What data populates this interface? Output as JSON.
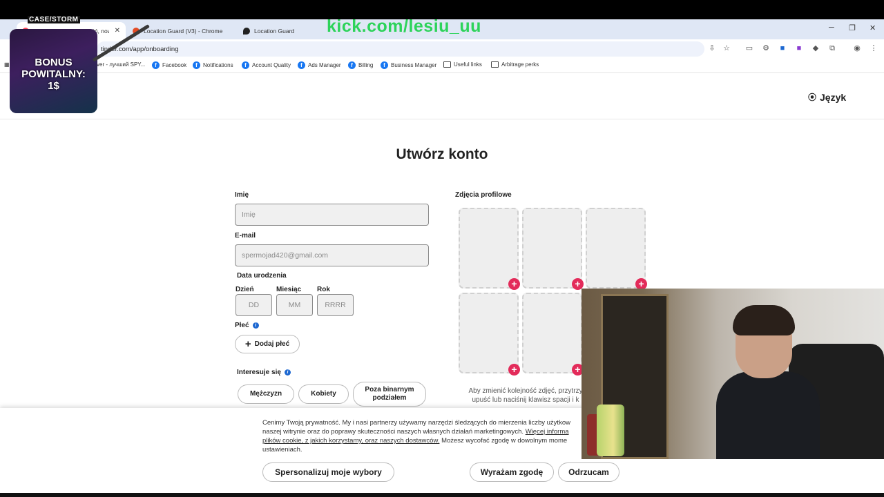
{
  "browser": {
    "tabs": [
      {
        "label": "Tinder | Randki, przyjaźń, nowe",
        "active": true
      },
      {
        "label": "Location Guard (V3) - Chrome",
        "active": false
      },
      {
        "label": "Location Guard",
        "active": false
      }
    ],
    "url": "tinder.com/app/onboarding",
    "bookmarks": [
      {
        "label": "ver - лучший SPY...",
        "icon": "page-icon"
      },
      {
        "label": "Facebook",
        "icon": "facebook-icon"
      },
      {
        "label": "Notifications",
        "icon": "facebook-icon"
      },
      {
        "label": "Account Quality",
        "icon": "facebook-icon"
      },
      {
        "label": "Ads Manager",
        "icon": "facebook-icon"
      },
      {
        "label": "Billing",
        "icon": "facebook-icon"
      },
      {
        "label": "Business Manager",
        "icon": "facebook-icon"
      },
      {
        "label": "Useful links",
        "icon": "folder-icon"
      },
      {
        "label": "Arbitrage perks",
        "icon": "folder-icon"
      }
    ]
  },
  "header": {
    "language_label": "Język"
  },
  "form": {
    "title": "Utwórz konto",
    "name": {
      "label": "Imię",
      "placeholder": "Imię"
    },
    "email": {
      "label": "E-mail",
      "value": "spermojad420@gmail.com"
    },
    "birthdate": {
      "label": "Data urodzenia",
      "day": {
        "label": "Dzień",
        "placeholder": "DD"
      },
      "month": {
        "label": "Miesiąc",
        "placeholder": "MM"
      },
      "year": {
        "label": "Rok",
        "placeholder": "RRRR"
      }
    },
    "gender": {
      "label": "Płeć",
      "add_label": "Dodaj płeć"
    },
    "interest": {
      "label": "Interesuje się",
      "options": [
        "Mężczyzn",
        "Kobiety",
        "Poza binarnym podziałem"
      ]
    }
  },
  "photos": {
    "label": "Zdjęcia profilowe",
    "hint_line1": "Aby zmienić kolejność zdjęć, przytrzy",
    "hint_line2": "upuść lub naciśnij klawisz spacji i k"
  },
  "cookie": {
    "text_part1": "Cenimy Twoją prywatność. My i nasi partnerzy używamy narzędzi śledzących do mierzenia liczby użytkow",
    "text_part2": "naszej witrynie oraz do poprawy skuteczności naszych własnych działań marketingowych.",
    "link1": "Więcej informa",
    "link2": "plików cookie, z jakich korzystamy, oraz naszych dostawców.",
    "text_part3": "Możesz wycofać zgodę w dowolnym mome",
    "text_part4": "ustawieniach.",
    "customize_label": "Spersonalizuj moje wybory",
    "accept_label": "Wyrażam zgodę",
    "reject_label": "Odrzucam"
  },
  "overlay": {
    "stream_url": "kick.com/lesiu_uu",
    "promo_brand": "CASE/STORM",
    "promo_line1": "BONUS",
    "promo_line2": "POWITALNY:",
    "promo_line3": "1$"
  },
  "colors": {
    "accent": "#e32b5a",
    "info": "#1d68d1",
    "stream_green": "#2dd35a"
  }
}
